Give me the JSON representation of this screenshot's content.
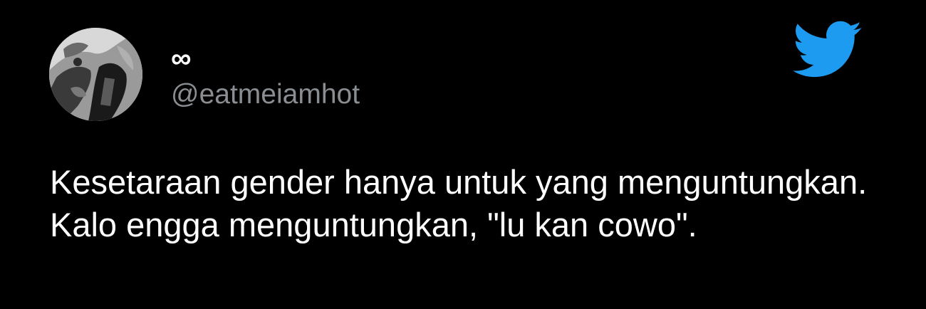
{
  "author": {
    "display_name": "∞",
    "handle": "@eatmeiamhot",
    "avatar_icon": "grayscale-portrait-avatar"
  },
  "brand": {
    "icon": "twitter-bird-icon",
    "color": "#1d9bf0"
  },
  "tweet": {
    "text": "Kesetaraan gender hanya untuk yang menguntungkan. Kalo engga menguntungkan, \"lu kan cowo\"."
  },
  "colors": {
    "background": "#000000",
    "text_primary": "#ffffff",
    "text_secondary": "#8a8d91"
  }
}
